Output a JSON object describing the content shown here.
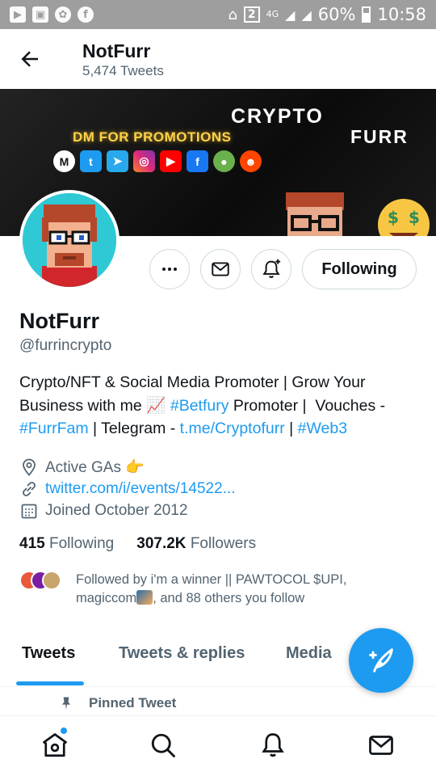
{
  "status_bar": {
    "network": "4G",
    "sim_slot": "2",
    "battery": "60%",
    "time": "10:58"
  },
  "header": {
    "title": "NotFurr",
    "subtitle": "5,474 Tweets"
  },
  "banner": {
    "promo_text": "DM FOR PROMOTIONS",
    "brand_word_1": "CRYPTO",
    "brand_word_2": "FURR",
    "social_icons": [
      "coinmarketcap-icon",
      "twitter-icon",
      "telegram-icon",
      "instagram-icon",
      "youtube-icon",
      "facebook-icon",
      "pepe-icon",
      "reddit-icon"
    ]
  },
  "actions": {
    "follow_label": "Following"
  },
  "profile": {
    "name": "NotFurr",
    "handle": "@furrincrypto",
    "bio": {
      "line1": "Crypto/NFT & Social Media Promoter | Grow Your",
      "line2_a": "Business with me",
      "line2_emoji": "📈",
      "line2_tag": "#Betfury",
      "line2_b": " Promoter |  Vouches -",
      "line3_tag": "#FurrFam",
      "line3_a": " | Telegram - ",
      "line3_link": "t.me/Cryptofurr",
      "line3_b": " | ",
      "line3_tag2": "#Web3"
    },
    "location": "Active GAs",
    "location_emoji": "👉",
    "website": "twitter.com/i/events/14522...",
    "joined": "Joined October 2012",
    "following_count": "415",
    "following_label": "Following",
    "followers_count": "307.2K",
    "followers_label": "Followers",
    "followed_by_line1": "Followed by i'm a winner || PAWTOCOL $UPI,",
    "followed_by_line2_a": "magiccom",
    "followed_by_line2_b": ", and 88 others you follow"
  },
  "tabs": [
    {
      "label": "Tweets"
    },
    {
      "label": "Tweets & replies"
    },
    {
      "label": "Media"
    }
  ],
  "pinned_label": "Pinned Tweet",
  "colors": {
    "accent": "#1d9bf0",
    "text": "#0f1419",
    "secondary": "#536471",
    "status_bar": "#9e9e9e"
  }
}
